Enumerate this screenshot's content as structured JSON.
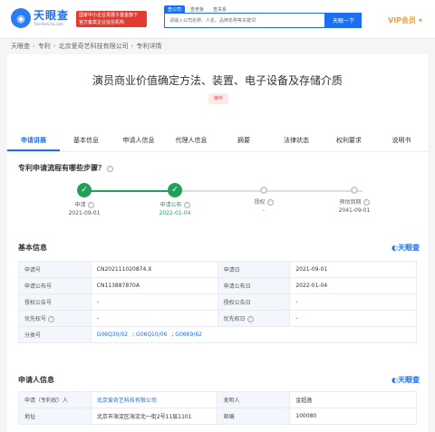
{
  "header": {
    "logo_cn": "天眼查",
    "logo_en": "TianYanCha.com",
    "promo_line1": "国家中小企业发展子基金旗下",
    "promo_line2": "官方备案企业征信机构",
    "search_tabs": [
      "查公司",
      "查老板",
      "查关系"
    ],
    "search_placeholder": "请输入公司名称、人名、品牌名称等关键词",
    "search_button": "天眼一下",
    "vip_label": "VIP会员"
  },
  "breadcrumb": [
    "天眼查",
    "专利",
    "北京爱奇艺科技有限公司",
    "专利详情"
  ],
  "patent": {
    "title": "演员商业价值确定方法、装置、电子设备及存储介质",
    "status": "审中"
  },
  "tabs": [
    "申请讲展",
    "基本信息",
    "申请人信息",
    "代理人信息",
    "摘要",
    "法律状态",
    "权利要求",
    "说明书"
  ],
  "progress": {
    "question": "专利申请流程有哪些步骤？",
    "steps": [
      {
        "label": "申请",
        "date": "2021-09-01",
        "done": true
      },
      {
        "label": "申请公布",
        "date": "2022-01-04",
        "done": true
      },
      {
        "label": "授权",
        "date": "-",
        "done": false
      },
      {
        "label": "预估到期",
        "date": "2041-09-01",
        "done": false
      }
    ]
  },
  "basic": {
    "title": "基本信息",
    "brand": "天眼查",
    "rows": [
      {
        "l1": "申请号",
        "v1": "CN202111020874.X",
        "l2": "申请日",
        "v2": "2021-09-01"
      },
      {
        "l1": "申请公布号",
        "v1": "CN113887870A",
        "l2": "申请公布日",
        "v2": "2022-01-04"
      },
      {
        "l1": "授权公告号",
        "v1": "-",
        "l2": "授权公告日",
        "v2": "-"
      },
      {
        "l1": "优先权号",
        "v1": "-",
        "l2": "优先权日",
        "v2": "-"
      }
    ],
    "class_label": "分类号",
    "class_codes": [
      "G06Q30/02",
      "G06Q10/06",
      "G06K9/62"
    ]
  },
  "applicant": {
    "title": "申请人信息",
    "brand": "天眼查",
    "rows": [
      {
        "l1": "申请（专利权）人",
        "v1": "北京爱奇艺科技有限公司",
        "l2": "发明人",
        "v2": "金超逸"
      },
      {
        "l1": "地址",
        "v1": "北京市海淀区海淀北一街2号11层1101",
        "l2": "邮编",
        "v2": "100080"
      }
    ]
  },
  "colors": {
    "accent": "#1b6ff2",
    "done": "#22a05a",
    "status": "#e2453a",
    "vip": "#e9a33d"
  }
}
